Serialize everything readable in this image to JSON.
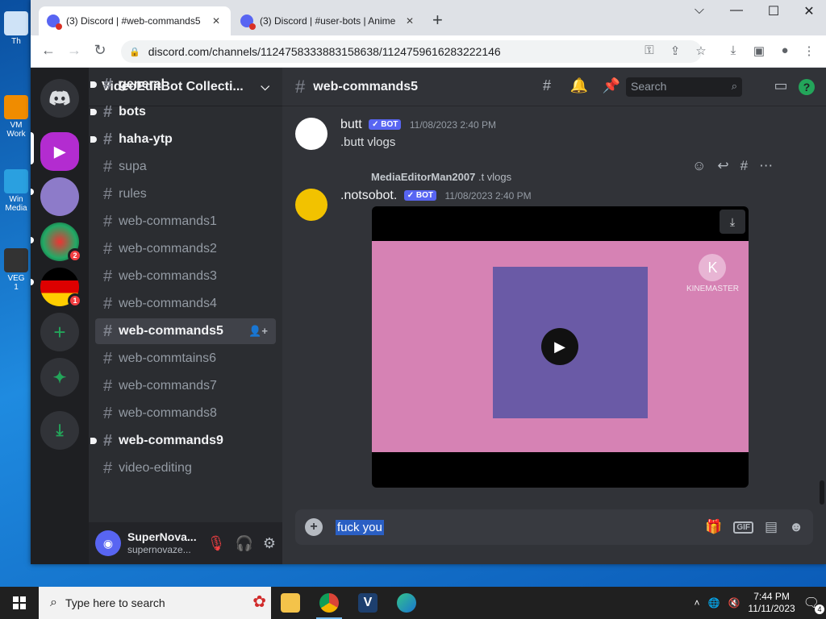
{
  "desktop": {
    "icons": [
      {
        "label": "Th",
        "color": "#cfe3f7"
      },
      {
        "label": "VM\nWork",
        "color": "#f08c00"
      },
      {
        "label": "Win\nMedia",
        "color": "#2aa0e0"
      },
      {
        "label": "VEG\n1",
        "color": "#333333"
      }
    ]
  },
  "browser": {
    "tabs": [
      {
        "title": "(3) Discord | #web-commands5",
        "close": "✕"
      },
      {
        "title": "(3) Discord | #user-bots | Anime",
        "close": "✕"
      }
    ],
    "new_tab": "+",
    "window_controls": [
      "⌵",
      "—",
      "☐",
      "✕"
    ],
    "url": "discord.com/channels/1124758333883158638/1124759616283222146",
    "nav": {
      "back": "←",
      "forward": "→",
      "reload": "↻",
      "lock": "🔒"
    }
  },
  "discord": {
    "server_name": "VideoEditBot Collecti...",
    "channels": [
      {
        "name": "general",
        "state": "unread",
        "dot": true
      },
      {
        "name": "bots",
        "state": "unread",
        "dot": true
      },
      {
        "name": "haha-ytp",
        "state": "unread",
        "dot": true
      },
      {
        "name": "supa",
        "state": "normal"
      },
      {
        "name": "rules",
        "state": "normal"
      },
      {
        "name": "web-commands1",
        "state": "normal"
      },
      {
        "name": "web-commands2",
        "state": "normal"
      },
      {
        "name": "web-commands3",
        "state": "normal"
      },
      {
        "name": "web-commands4",
        "state": "normal"
      },
      {
        "name": "web-commands5",
        "state": "active"
      },
      {
        "name": "web-commtains6",
        "state": "normal"
      },
      {
        "name": "web-commands7",
        "state": "normal"
      },
      {
        "name": "web-commands8",
        "state": "normal"
      },
      {
        "name": "web-commands9",
        "state": "unread",
        "dot": true
      },
      {
        "name": "video-editing",
        "state": "normal"
      }
    ],
    "guild_badges": [
      "2",
      "1"
    ],
    "user": {
      "name": "SuperNova...",
      "tag": "supernovaze..."
    },
    "channel_header": "web-commands5",
    "search_placeholder": "Search",
    "help": "?",
    "messages": [
      {
        "author": "butt",
        "badge": "✓ BOT",
        "timestamp": "11/08/2023 2:40 PM",
        "text": ".butt vlogs"
      },
      {
        "reply_author": "MediaEditorMan2007",
        "reply_text": ".t vlogs",
        "author": ".notsobot.",
        "badge": "✓ BOT",
        "timestamp": "11/08/2023 2:40 PM"
      }
    ],
    "video": {
      "watermark": "KINEMASTER",
      "watermark_letter": "K"
    },
    "composer": {
      "text": "fuck you",
      "gif": "GIF"
    }
  },
  "taskbar": {
    "search_placeholder": "Type here to search",
    "time": "7:44 PM",
    "date": "11/11/2023",
    "notification_count": "4"
  }
}
